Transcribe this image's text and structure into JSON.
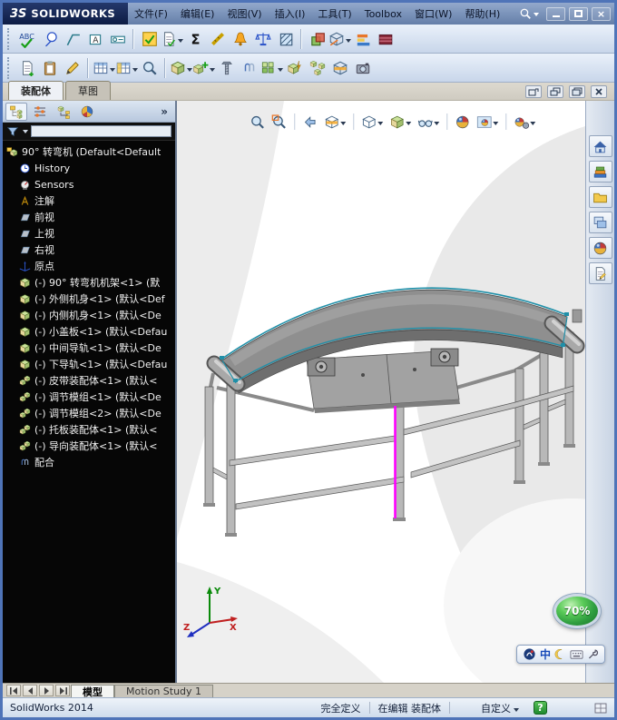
{
  "titlebar": {
    "logo_mark": "3S",
    "logo_text": "SOLIDWORKS",
    "menus": [
      "文件(F)",
      "编辑(E)",
      "视图(V)",
      "插入(I)",
      "工具(T)",
      "Toolbox",
      "窗口(W)",
      "帮助(H)"
    ],
    "close_glyph": "×"
  },
  "command_tabs": {
    "assembly": "装配体",
    "sketch": "草图"
  },
  "glyphs": {
    "spell": "ABC",
    "sigma": "Σ",
    "datum_letter": "A",
    "panel_chevron": "»",
    "help": "?"
  },
  "feature_tree": {
    "items": [
      {
        "label": "90° 转弯机  (Default<Default",
        "icon": "assembly"
      },
      {
        "label": "History",
        "icon": "history"
      },
      {
        "label": "Sensors",
        "icon": "sensors"
      },
      {
        "label": "注解",
        "icon": "annotations"
      },
      {
        "label": "前视",
        "icon": "plane"
      },
      {
        "label": "上视",
        "icon": "plane"
      },
      {
        "label": "右视",
        "icon": "plane"
      },
      {
        "label": "原点",
        "icon": "origin"
      },
      {
        "label": "(-) 90° 转弯机机架<1> (默",
        "icon": "part"
      },
      {
        "label": "(-) 外侧机身<1> (默认<Def",
        "icon": "part"
      },
      {
        "label": "(-) 内侧机身<1> (默认<De",
        "icon": "part"
      },
      {
        "label": "(-) 小盖板<1> (默认<Defau",
        "icon": "part"
      },
      {
        "label": "(-) 中间导轨<1> (默认<De",
        "icon": "part"
      },
      {
        "label": "(-) 下导轨<1> (默认<Defau",
        "icon": "part"
      },
      {
        "label": "(-) 皮带装配体<1> (默认<",
        "icon": "subassembly"
      },
      {
        "label": "(-) 调节模组<1> (默认<De",
        "icon": "subassembly"
      },
      {
        "label": "(-) 调节模组<2> (默认<De",
        "icon": "subassembly"
      },
      {
        "label": "(-) 托板装配体<1> (默认<",
        "icon": "subassembly"
      },
      {
        "label": "(-) 导向装配体<1> (默认<",
        "icon": "subassembly"
      },
      {
        "label": "配合",
        "icon": "mates"
      }
    ]
  },
  "viewport": {
    "zoom_badge": "70%",
    "triad": {
      "x": "X",
      "y": "Y",
      "z": "Z"
    }
  },
  "ime": {
    "mode": "中"
  },
  "bottom_tabs": {
    "model": "模型",
    "motion": "Motion Study 1"
  },
  "statusbar": {
    "app_version": "SolidWorks 2014",
    "definition_status": "完全定义",
    "edit_status": "在编辑 装配体",
    "custom_label": "自定义"
  },
  "icons": {
    "toolbar_row1": [
      "spell-check",
      "balloon-note",
      "surface-finish",
      "datum-feature",
      "geometric-tolerance",
      "design-checker",
      "check-document",
      "equations",
      "measure",
      "performance-evaluation",
      "mass-properties",
      "section-properties",
      "interference-detection",
      "clearance-verification",
      "assembly-visualization",
      "deviation-analysis"
    ],
    "toolbar_row2": [
      "new-document",
      "paste",
      "annotation-pencil",
      "bill-of-materials",
      "design-table",
      "magnified-selection",
      "insert-component",
      "component-preview",
      "smart-fasteners",
      "mate",
      "linear-component-pattern",
      "smart-component",
      "exploded-view",
      "assembly-section",
      "camera-view"
    ],
    "heads_up": [
      "zoom-to-fit",
      "zoom-to-area",
      "previous-view",
      "section-view",
      "view-orientation",
      "display-style",
      "hide-show-items",
      "edit-appearance",
      "apply-scene",
      "view-settings"
    ],
    "task_pane": [
      "solidworks-resources",
      "design-library",
      "file-explorer",
      "view-palette",
      "appearances",
      "custom-properties"
    ],
    "manager_tabs": [
      "feature-manager",
      "property-manager",
      "configuration-manager",
      "display-manager"
    ]
  },
  "colors": {
    "selection_magenta": "#ff00ff",
    "edge_teal": "#1f8fa8",
    "zoom_badge_green": "#2f9e3f",
    "titlebar_blue": "#24386b"
  }
}
